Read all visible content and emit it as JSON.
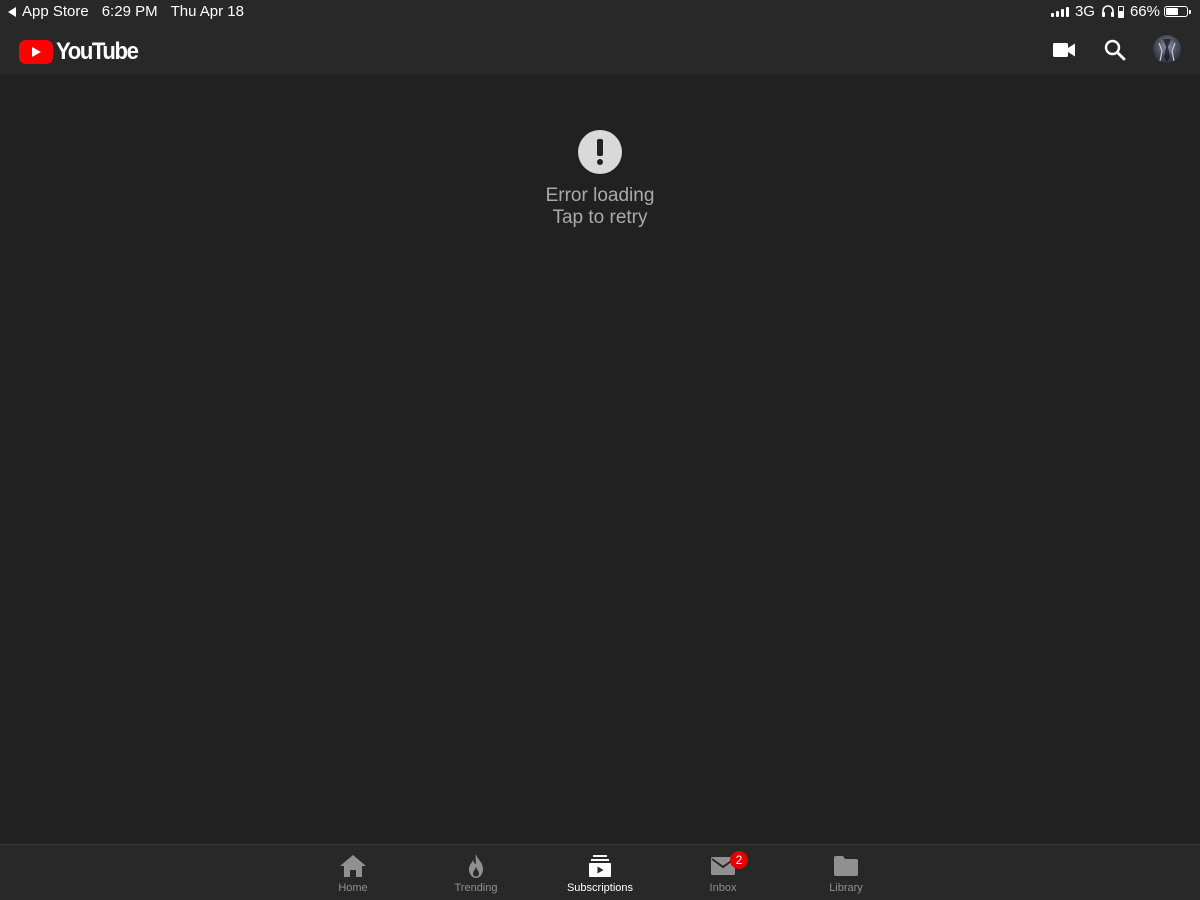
{
  "status_bar": {
    "back_label": "App Store",
    "time": "6:29 PM",
    "date": "Thu Apr 18",
    "network": "3G",
    "battery_percent": "66%",
    "battery_level": 0.66
  },
  "app_bar": {
    "logo_text": "YouTube",
    "icons": [
      "video-camera-icon",
      "search-icon",
      "avatar"
    ]
  },
  "error": {
    "icon": "exclamation-circle-icon",
    "title": "Error loading",
    "subtitle": "Tap to retry"
  },
  "bottom_nav": {
    "items": [
      {
        "label": "Home",
        "icon": "home-icon",
        "active": false
      },
      {
        "label": "Trending",
        "icon": "flame-icon",
        "active": false
      },
      {
        "label": "Subscriptions",
        "icon": "subscriptions-icon",
        "active": true
      },
      {
        "label": "Inbox",
        "icon": "mail-icon",
        "active": false,
        "badge": "2"
      },
      {
        "label": "Library",
        "icon": "folder-icon",
        "active": false
      }
    ]
  },
  "colors": {
    "background": "#212121",
    "bar": "#282828",
    "brand_red": "#ff0000",
    "badge_red": "#e00000",
    "muted_text": "#aaaaaa"
  }
}
